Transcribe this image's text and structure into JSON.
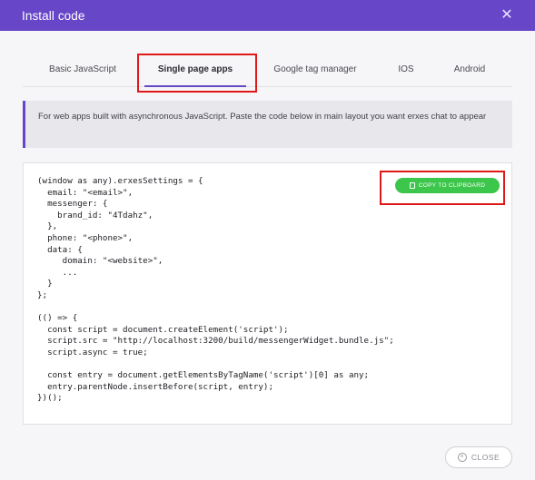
{
  "modal": {
    "title": "Install code",
    "close_icon_glyph": "✕"
  },
  "tabs": [
    {
      "label": "Basic JavaScript",
      "active": false
    },
    {
      "label": "Single page apps",
      "active": true
    },
    {
      "label": "Google tag manager",
      "active": false
    },
    {
      "label": "IOS",
      "active": false
    },
    {
      "label": "Android",
      "active": false
    }
  ],
  "info": {
    "text": "For web apps built with asynchronous JavaScript. Paste the code below in main layout you want erxes chat to appear"
  },
  "code": {
    "snippet": "(window as any).erxesSettings = {\n  email: \"<email>\",\n  messenger: {\n    brand_id: \"4Tdahz\",\n  },\n  phone: \"<phone>\",\n  data: {\n     domain: \"<website>\",\n     ...\n  }\n};\n\n(() => {\n  const script = document.createElement('script');\n  script.src = \"http://localhost:3200/build/messengerWidget.bundle.js\";\n  script.async = true;\n\n  const entry = document.getElementsByTagName('script')[0] as any;\n  entry.parentNode.insertBefore(script, entry);\n})();",
    "copy_label": "COPY TO CLIPBOARD"
  },
  "footer": {
    "close_label": "CLOSE"
  },
  "colors": {
    "header": "#6746c8",
    "accent": "#6746c8",
    "copy_button": "#3cc64b",
    "highlight_box": "#e01818"
  },
  "icons": {
    "header_close": "close-icon",
    "copy": "copy-icon",
    "footer_close": "close-circle-icon"
  }
}
